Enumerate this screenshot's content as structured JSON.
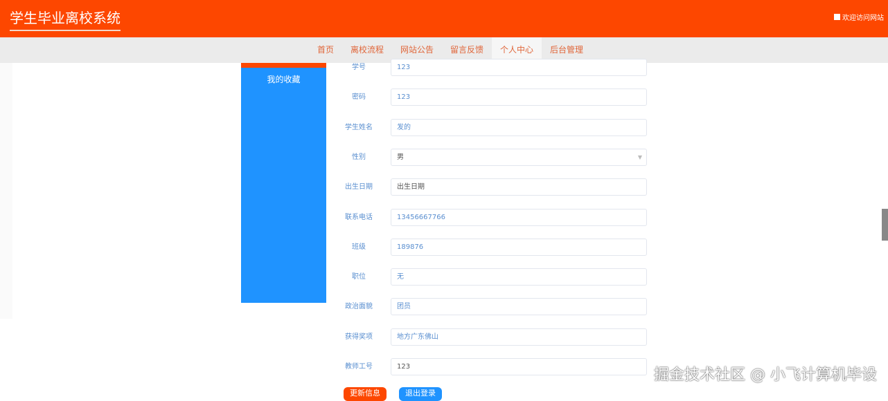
{
  "header": {
    "title": "学生毕业离校系统",
    "welcome": "欢迎访问网站"
  },
  "nav": [
    "首页",
    "离校流程",
    "网站公告",
    "留言反馈",
    "个人中心",
    "后台管理"
  ],
  "sidebar": {
    "items": [
      "我的收藏"
    ]
  },
  "form": [
    {
      "label": "学号",
      "value": "123"
    },
    {
      "label": "密码",
      "value": "123"
    },
    {
      "label": "学生姓名",
      "value": "发的"
    },
    {
      "label": "性别",
      "value": "男"
    },
    {
      "label": "出生日期",
      "value": "出生日期"
    },
    {
      "label": "联系电话",
      "value": "13456667766"
    },
    {
      "label": "班级",
      "value": "189876"
    },
    {
      "label": "职位",
      "value": "无"
    },
    {
      "label": "政治面貌",
      "value": "团员"
    },
    {
      "label": "获得奖项",
      "value": "地方广东佛山"
    },
    {
      "label": "教师工号",
      "value": "123"
    }
  ],
  "buttons": {
    "update": "更新信息",
    "logout": "退出登录"
  },
  "watermark": "掘金技术社区 @ 小飞计算机毕设"
}
